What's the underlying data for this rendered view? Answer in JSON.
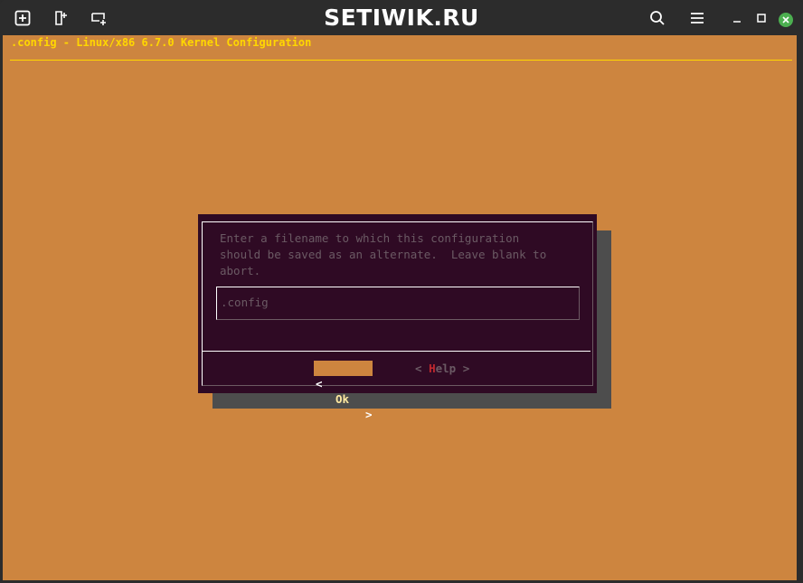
{
  "window": {
    "title": "SETIWIK.RU"
  },
  "toolbar": {
    "icons": [
      "new-tab-icon",
      "split-icon",
      "window-icon",
      "search-icon",
      "menu-icon",
      "minimize-icon",
      "maximize-icon",
      "close-icon"
    ],
    "close_color": "#4caf50"
  },
  "terminal": {
    "backtitle": ".config - Linux/x86 6.7.0 Kernel Configuration",
    "background": "#cd853f",
    "accent": "#ffd700"
  },
  "dialog": {
    "prompt_lines": [
      "Enter a filename to which this configuration",
      "should be saved as an alternate.  Leave blank to",
      "abort."
    ],
    "input": {
      "value": ".config"
    },
    "ok_button": {
      "left_bracket": "<",
      "label": "Ok",
      "right_bracket": ">"
    },
    "help_button": {
      "left_bracket": "<",
      "hotkey": "H",
      "label_rest": "elp",
      "right_bracket": ">"
    },
    "background": "#2f0a24"
  }
}
